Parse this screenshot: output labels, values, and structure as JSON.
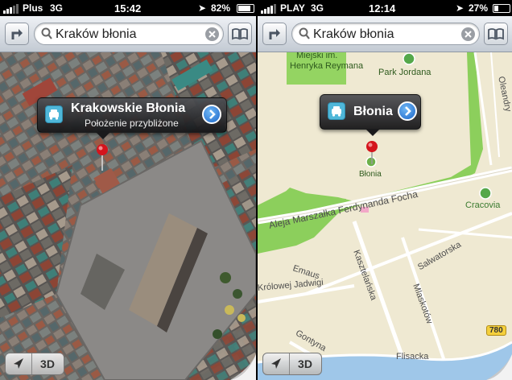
{
  "left": {
    "status": {
      "carrier": "Plus",
      "network": "3G",
      "time": "15:42",
      "battery": "82%"
    },
    "search": {
      "query": "Kraków błonia"
    },
    "callout": {
      "title": "Krakowskie Błonia",
      "subtitle": "Położenie przybliżone"
    },
    "map_mode": "satellite",
    "bottom": {
      "mode_label": "3D"
    }
  },
  "right": {
    "status": {
      "carrier": "PLAY",
      "network": "3G",
      "time": "12:14",
      "battery": "27%"
    },
    "search": {
      "query": "Kraków błonia"
    },
    "callout": {
      "title": "Błonia"
    },
    "map_mode": "standard",
    "labels": {
      "park_reymana_1": "Miejski im.",
      "park_reymana_2": "Henryka Reymana",
      "park_jordana": "Park Jordana",
      "olean": "Oleandry",
      "pin_label": "Błonia",
      "focha": "Aleja Marszałka Ferdynanda Focha",
      "cracovia": "Cracovia",
      "kasztelanska": "Kasztelańska",
      "salwatorska": "Salwatorska",
      "emaus": "Emaus",
      "krolowej": "Królowej Jadwigi",
      "mlaskotow": "Mlaskotów",
      "gontyna": "Gontyna",
      "flisacka": "Flisacka",
      "road_shield": "780"
    },
    "bottom": {
      "mode_label": "3D"
    }
  },
  "colors": {
    "park_green": "#8ccf5c",
    "map_bg": "#efe9d2",
    "road": "#ffffff",
    "water": "#9fc7e9",
    "pin_red": "#d4141c",
    "callout_chevron": "#1d66c8"
  }
}
